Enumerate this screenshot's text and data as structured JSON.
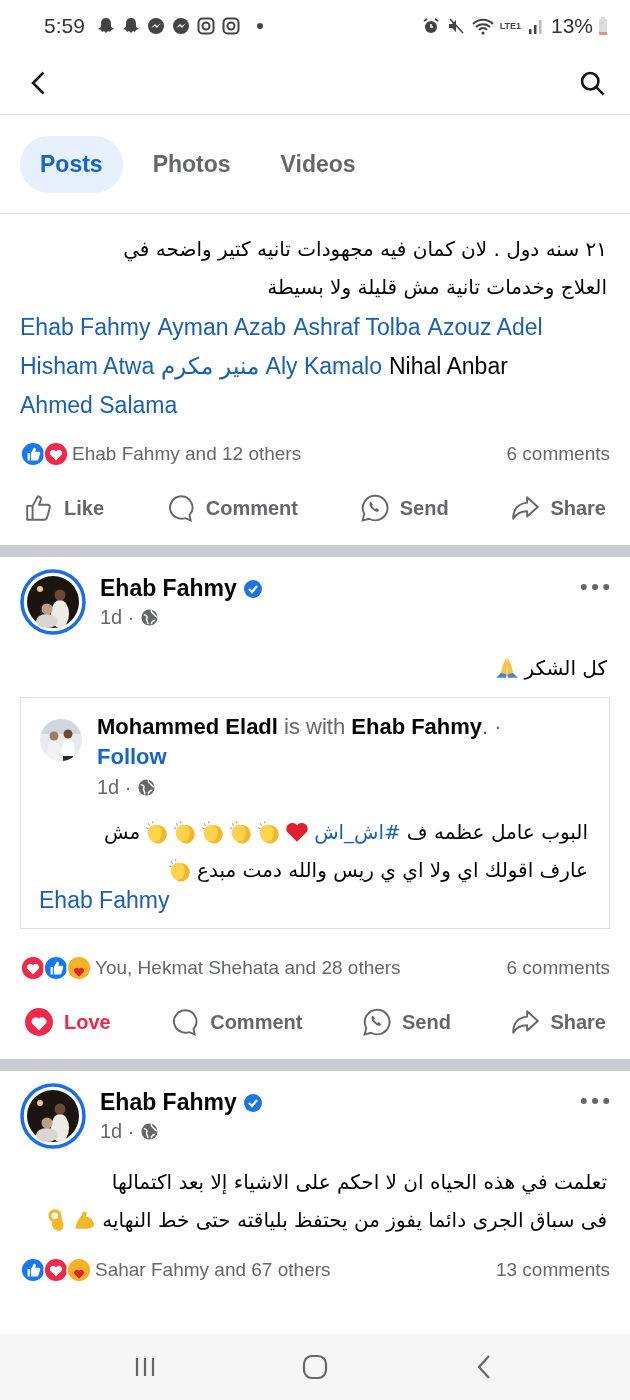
{
  "status_bar": {
    "time": "5:59",
    "network": "LTE1",
    "battery": "13%"
  },
  "tabs": [
    {
      "label": "Posts",
      "selected": true
    },
    {
      "label": "Photos",
      "selected": false
    },
    {
      "label": "Videos",
      "selected": false
    }
  ],
  "posts": [
    {
      "body": [
        {
          "kind": "text",
          "text": "٢١ سنه دول . لان كمان فيه مجهودات تانيه كتير واضحه في"
        },
        {
          "kind": "text",
          "text": "العلاج وخدمات تانية مش قليلة ولا بسيطة"
        }
      ],
      "mentions": [
        {
          "text": "Ehab Fahmy",
          "linked": true
        },
        {
          "text": "Ayman Azab",
          "linked": true
        },
        {
          "text": "Ashraf Tolba",
          "linked": true
        },
        {
          "text": "Azouz Adel",
          "linked": true
        },
        {
          "text": "Hisham Atwa",
          "linked": true
        },
        {
          "text": "منير مكرم",
          "linked": true
        },
        {
          "text": "Aly Kamalo",
          "linked": true
        },
        {
          "text": "Nihal Anbar",
          "linked": false
        },
        {
          "text": "Ahmed Salama",
          "linked": true
        }
      ],
      "reactions": {
        "icons": [
          {
            "kind": "like"
          },
          {
            "kind": "love"
          }
        ],
        "summary": "Ehab Fahmy and 12 others",
        "comments": "6 comments"
      },
      "actions": [
        {
          "kind": "like",
          "label": "Like",
          "selected": false
        },
        {
          "kind": "comment",
          "label": "Comment",
          "selected": false
        },
        {
          "kind": "send",
          "label": "Send",
          "selected": false
        },
        {
          "kind": "share",
          "label": "Share",
          "selected": false
        }
      ]
    },
    {
      "author": {
        "name": "Ehab Fahmy",
        "verified": true,
        "time": "1d ·"
      },
      "body": [
        {
          "kind": "text",
          "text": "كل الشكر"
        },
        {
          "kind": "pray"
        }
      ],
      "shared": {
        "header": "**Mohammed Eladl** is with **Ehab Fahmy**. ·",
        "follow": "Follow",
        "time": "1d ·",
        "lines": [
          [
            {
              "kind": "text",
              "text": "البوب عامل عظمه ف"
            },
            {
              "kind": "hashtag",
              "text": "#اش_اش"
            },
            {
              "kind": "heart"
            },
            {
              "kind": "clap"
            },
            {
              "kind": "clap"
            },
            {
              "kind": "clap"
            },
            {
              "kind": "clap"
            },
            {
              "kind": "clap"
            },
            {
              "kind": "text",
              "text": "مش"
            }
          ],
          [
            {
              "kind": "text",
              "text": "عارف اقولك اي ولا اي ي ريس والله دمت مبدع"
            },
            {
              "kind": "clap"
            }
          ]
        ],
        "mention": "Ehab Fahmy"
      },
      "reactions": {
        "icons": [
          {
            "kind": "love"
          },
          {
            "kind": "like"
          },
          {
            "kind": "care"
          }
        ],
        "summary": "You, Hekmat Shehata and 28 others",
        "comments": "6 comments"
      },
      "actions": [
        {
          "kind": "love",
          "label": "Love",
          "selected": true
        },
        {
          "kind": "comment",
          "label": "Comment",
          "selected": false
        },
        {
          "kind": "send",
          "label": "Send",
          "selected": false
        },
        {
          "kind": "share",
          "label": "Share",
          "selected": false
        }
      ]
    },
    {
      "author": {
        "name": "Ehab Fahmy",
        "verified": true,
        "time": "1d ·"
      },
      "body": [
        {
          "kind": "text",
          "text": "تعلمت في هذه الحياه ان لا احكم على  الاشياء إلا بعد اكتمالها"
        },
        {
          "kind": "text",
          "text": "فى سباق الجرى دائما يفوز من يحتفظ بلياقته حتى خط النهايه"
        },
        {
          "kind": "muscle"
        },
        {
          "kind": "ok"
        }
      ],
      "reactions": {
        "icons": [
          {
            "kind": "like"
          },
          {
            "kind": "love"
          },
          {
            "kind": "care"
          }
        ],
        "summary": "Sahar Fahmy and 67 others",
        "comments": "13 comments"
      }
    }
  ]
}
